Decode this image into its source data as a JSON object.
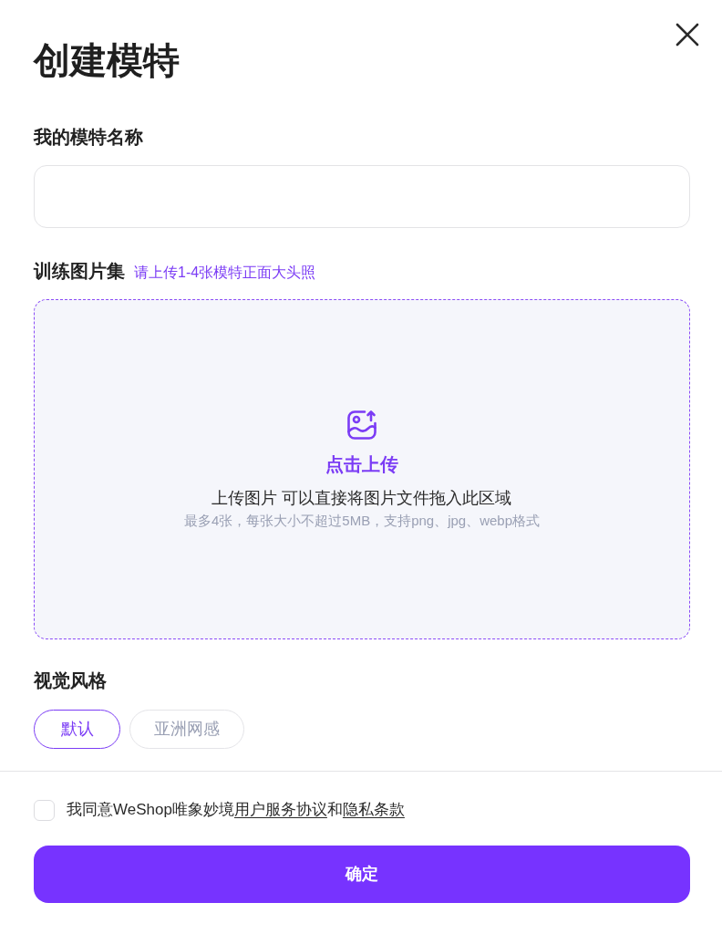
{
  "dialog": {
    "title": "创建模特"
  },
  "name_field": {
    "label": "我的模特名称"
  },
  "training_images": {
    "label": "训练图片集",
    "hint": "请上传1-4张模特正面大头照",
    "upload": {
      "action": "点击上传",
      "instruction": "上传图片 可以直接将图片文件拖入此区域",
      "limits": "最多4张，每张大小不超过5MB，支持png、jpg、webp格式"
    }
  },
  "visual_style": {
    "label": "视觉风格",
    "options": [
      {
        "label": "默认",
        "selected": true
      },
      {
        "label": "亚洲网感",
        "selected": false
      }
    ]
  },
  "agreement": {
    "checked": false,
    "parts": [
      {
        "kind": "text",
        "text": "我同意WeShop唯象妙境"
      },
      {
        "kind": "link",
        "text": "用户服务协议"
      },
      {
        "kind": "text",
        "text": "和"
      },
      {
        "kind": "link",
        "text": "隐私条款"
      }
    ]
  },
  "confirm_button": {
    "label": "确定"
  }
}
